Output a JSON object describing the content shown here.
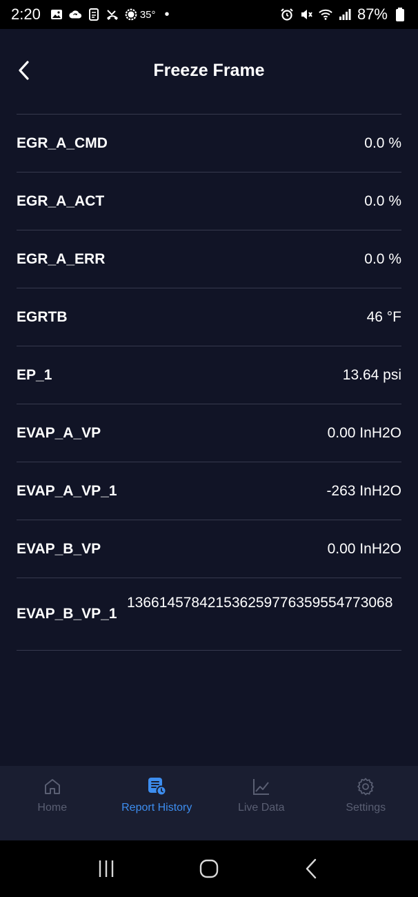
{
  "status_bar": {
    "time": "2:20",
    "temperature": "35°",
    "dot": "•",
    "battery": "87%",
    "icons_left": [
      "gallery-icon",
      "cloud-sync-icon",
      "document-icon",
      "missed-call-icon",
      "weather-icon"
    ],
    "icons_right": [
      "alarm-icon",
      "mute-icon",
      "wifi-icon",
      "signal-icon",
      "battery-icon"
    ]
  },
  "header": {
    "title": "Freeze Frame",
    "back_icon": "chevron-left-icon"
  },
  "rows": [
    {
      "label": "EGR_A_CMD",
      "value": "0.0 %"
    },
    {
      "label": "EGR_A_ACT",
      "value": "0.0 %"
    },
    {
      "label": "EGR_A_ERR",
      "value": "0.0 %"
    },
    {
      "label": "EGRTB",
      "value": "46 °F"
    },
    {
      "label": "EP_1",
      "value": "13.64 psi"
    },
    {
      "label": "EVAP_A_VP",
      "value": "0.00 InH2O"
    },
    {
      "label": "EVAP_A_VP_1",
      "value": "-263 InH2O"
    },
    {
      "label": "EVAP_B_VP",
      "value": "0.00 InH2O"
    },
    {
      "label": "EVAP_B_VP_1",
      "value": "136614578421536259776359554773068"
    }
  ],
  "bottom_nav": {
    "items": [
      {
        "label": "Home",
        "icon": "home-icon",
        "active": false
      },
      {
        "label": "Report History",
        "icon": "report-history-icon",
        "active": true
      },
      {
        "label": "Live Data",
        "icon": "line-chart-icon",
        "active": false
      },
      {
        "label": "Settings",
        "icon": "gear-icon",
        "active": false
      }
    ]
  },
  "colors": {
    "background": "#111426",
    "nav_background": "#1a1e31",
    "divider": "#373a4e",
    "accent": "#3d8ef0",
    "inactive": "#5a5f73"
  }
}
